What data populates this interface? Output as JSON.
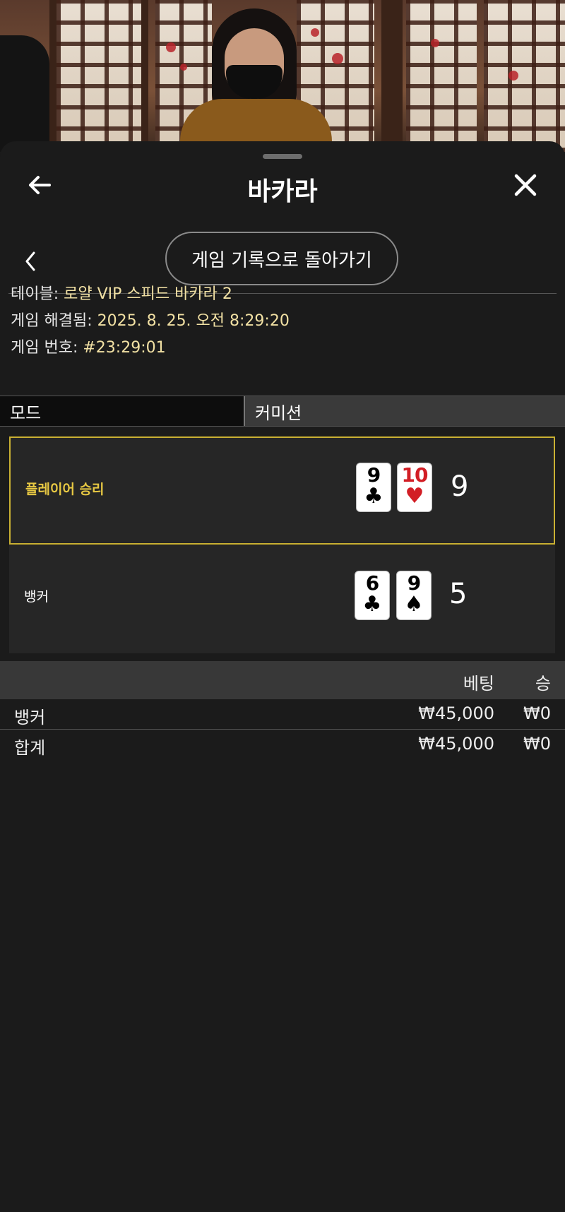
{
  "header": {
    "title": "바카라"
  },
  "nav": {
    "history_button": "게임 기록으로 돌아가기"
  },
  "info": {
    "table_label": "테이블:",
    "table_value": "로얄 VIP 스피드 바카라 2",
    "resolved_label": "게임 해결됨:",
    "resolved_value": "2025. 8. 25. 오전 8:29:20",
    "game_no_label": "게임 번호:",
    "game_no_value": "#23:29:01"
  },
  "tabs": {
    "mode": "모드",
    "commission": "커미션"
  },
  "hands": [
    {
      "label": "플레이어 승리",
      "score": "9",
      "winner": true,
      "cards": [
        {
          "rank": "9",
          "suit": "♣",
          "red": false
        },
        {
          "rank": "10",
          "suit": "♥",
          "red": true
        }
      ]
    },
    {
      "label": "뱅커",
      "score": "5",
      "winner": false,
      "cards": [
        {
          "rank": "6",
          "suit": "♣",
          "red": false
        },
        {
          "rank": "9",
          "suit": "♠",
          "red": false
        }
      ]
    }
  ],
  "bets": {
    "columns": {
      "bet": "베팅",
      "win": "승"
    },
    "rows": [
      {
        "name": "뱅커",
        "bet": "₩45,000",
        "win": "₩0"
      }
    ],
    "total": {
      "name": "합계",
      "bet": "₩45,000",
      "win": "₩0"
    }
  },
  "colors": {
    "accent": "#e7c843",
    "winner_border": "#c9b033",
    "background": "#1b1b1b"
  },
  "icons": {
    "back": "arrow-left-icon",
    "close": "close-icon",
    "chevron": "chevron-left-icon"
  }
}
